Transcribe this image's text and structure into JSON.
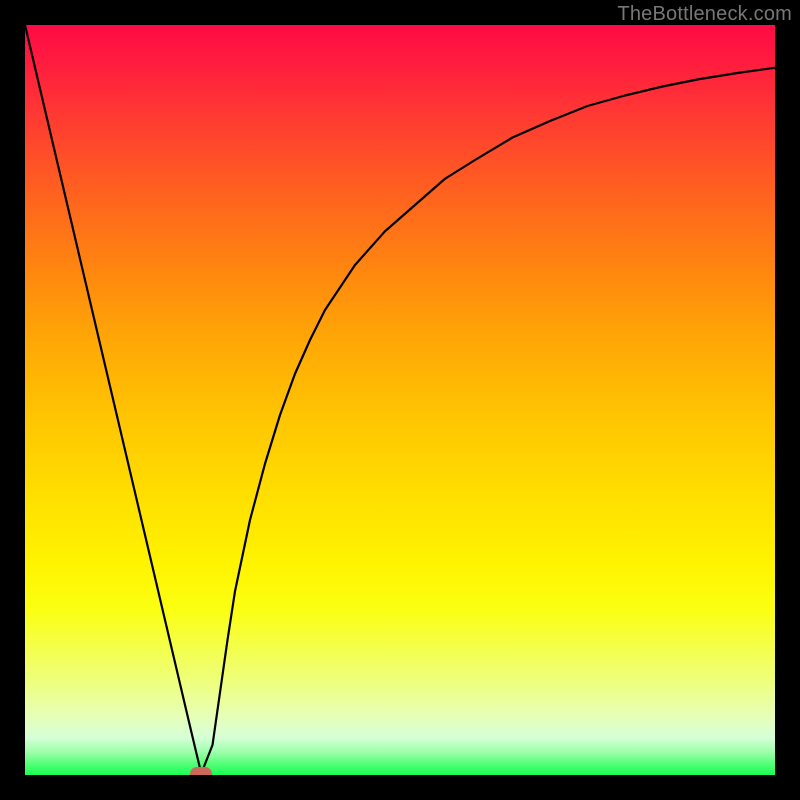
{
  "watermark": "TheBottleneck.com",
  "chart_data": {
    "type": "line",
    "title": "",
    "xlabel": "",
    "ylabel": "",
    "xlim": [
      0,
      100
    ],
    "ylim": [
      0,
      100
    ],
    "grid": false,
    "series": [
      {
        "name": "bottleneck-curve",
        "x": [
          0,
          2,
          4,
          6,
          8,
          10,
          12,
          14,
          16,
          18,
          20,
          22,
          23.5,
          25,
          26,
          27,
          28,
          30,
          32,
          34,
          36,
          38,
          40,
          44,
          48,
          52,
          56,
          60,
          65,
          70,
          75,
          80,
          85,
          90,
          95,
          100
        ],
        "y": [
          100,
          91.5,
          83,
          74.5,
          66,
          57.5,
          49,
          40.5,
          32,
          23.5,
          15,
          6.5,
          0.2,
          4,
          11,
          18,
          24.5,
          34,
          41.5,
          48,
          53.5,
          58,
          62,
          68,
          72.5,
          76,
          79.5,
          82,
          85,
          87.2,
          89.2,
          90.6,
          91.8,
          92.8,
          93.6,
          94.3
        ]
      }
    ],
    "marker": {
      "x": 23.5,
      "y": 0.2
    },
    "background": {
      "type": "vertical-gradient",
      "stops": [
        [
          "#ff0b45",
          0
        ],
        [
          "#ff6020",
          22
        ],
        [
          "#ffa706",
          42
        ],
        [
          "#ffdd00",
          62
        ],
        [
          "#fff400",
          72
        ],
        [
          "#edff82",
          88
        ],
        [
          "#17ff50",
          100
        ]
      ]
    }
  }
}
